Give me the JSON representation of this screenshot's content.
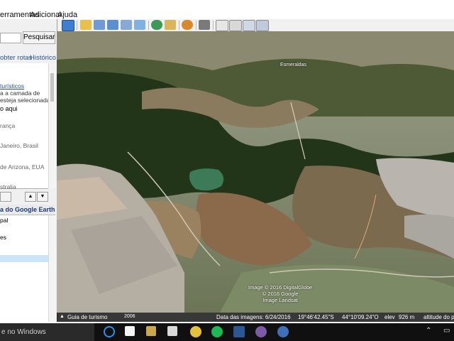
{
  "menu": {
    "items": [
      "erramentas",
      "Adicionar",
      "Ajuda"
    ]
  },
  "search": {
    "button_label": "Pesquisar",
    "placeholder": ""
  },
  "tabs": [
    "obter rotas",
    "Histórico"
  ],
  "sidebar_results": {
    "lines": [
      "turísticos",
      "a a camada de",
      "esteja selecionada",
      "o aqui",
      "rança",
      "Janeiro, Brasil",
      "de Arizona, EUA",
      "stralia"
    ]
  },
  "layers": {
    "header": "a do Google Earth",
    "items": [
      "pal",
      "es"
    ]
  },
  "map": {
    "place_label": "Esmeraldas",
    "credits": [
      "Image © 2016 DigitalGlobe",
      "© 2016 Google",
      "Image Landsat"
    ]
  },
  "tour_guide": {
    "label": "Guia de turismo",
    "year": "2006"
  },
  "statusbar": {
    "imagery_date": "Data das imagens: 6/24/2016",
    "lat": "19°46'42.45\"S",
    "lon": "44°10'09.24\"O",
    "elev_label": "elev",
    "elev_value": "926 m",
    "eye_alt": "altitude do po"
  },
  "taskbar": {
    "search_text": "e no Windows"
  },
  "colors": {
    "taskbar": "#101010",
    "link": "#2a4f9a",
    "terrain_dark": "#233518",
    "terrain_light": "#8a7a5e"
  }
}
